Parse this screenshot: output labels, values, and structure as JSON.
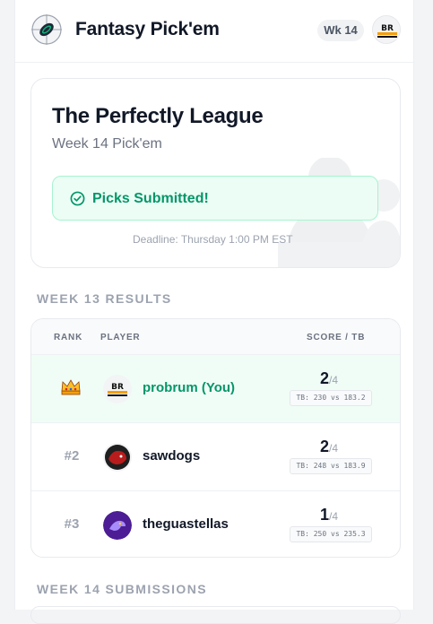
{
  "header": {
    "app_title": "Fantasy Pick'em",
    "week_badge": "Wk 14",
    "avatar_icon": "bron-logo-avatar"
  },
  "hero": {
    "league_name": "The Perfectly League",
    "subtitle": "Week 14 Pick'em",
    "status_text": "Picks Submitted!",
    "deadline": "Deadline: Thursday 1:00 PM EST"
  },
  "results": {
    "section_title": "WEEK 13 RESULTS",
    "columns": {
      "rank": "RANK",
      "player": "PLAYER",
      "score": "SCORE / TB"
    },
    "rows": [
      {
        "rank": "",
        "rank_icon": "crown-icon",
        "player": "probrum (You)",
        "score": "2",
        "out_of": "/4",
        "tb": "TB: 230 vs 183.2",
        "is_me": true,
        "avatar": "bron-logo-avatar"
      },
      {
        "rank": "#2",
        "player": "sawdogs",
        "score": "2",
        "out_of": "/4",
        "tb": "TB: 248 vs 183.9",
        "is_me": false,
        "avatar": "red-dog-avatar"
      },
      {
        "rank": "#3",
        "player": "theguastellas",
        "score": "1",
        "out_of": "/4",
        "tb": "TB: 250 vs 235.3",
        "is_me": false,
        "avatar": "purple-avatar"
      }
    ]
  },
  "submissions": {
    "section_title": "WEEK 14 SUBMISSIONS"
  },
  "colors": {
    "accent_green": "#059669",
    "success_bg": "#ecfdf5",
    "muted": "#9ca3af"
  }
}
